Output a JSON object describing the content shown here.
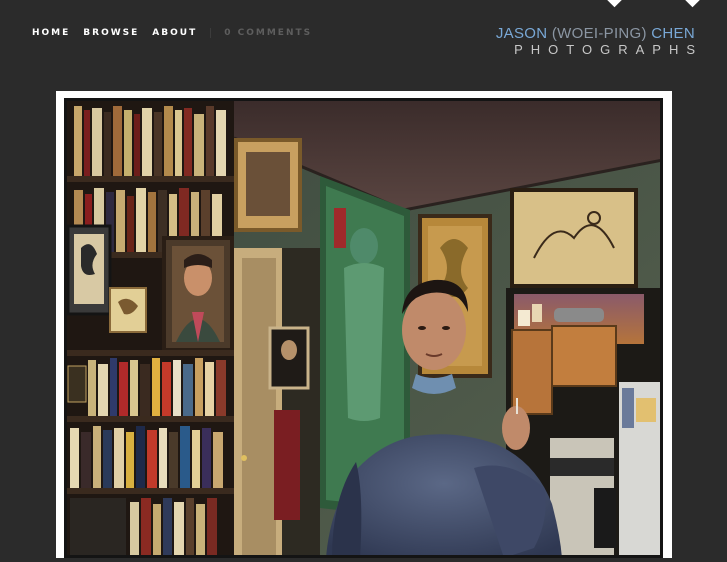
{
  "nav": {
    "items": [
      {
        "label": "HOME"
      },
      {
        "label": "BROWSE"
      },
      {
        "label": "ABOUT"
      }
    ],
    "comments_label": "0 COMMENTS"
  },
  "brand": {
    "first": "JASON",
    "middle": "(WOEI-PING)",
    "last": "CHEN",
    "subtitle": "PHOTOGRAPHS"
  },
  "colors": {
    "background": "#2b2b2b",
    "accent": "#79a8d6",
    "frame": "#ffffff"
  },
  "photo": {
    "icons": [
      "bookshelf",
      "portrait-painting",
      "kitchen-doorway",
      "man-in-sweater"
    ]
  }
}
